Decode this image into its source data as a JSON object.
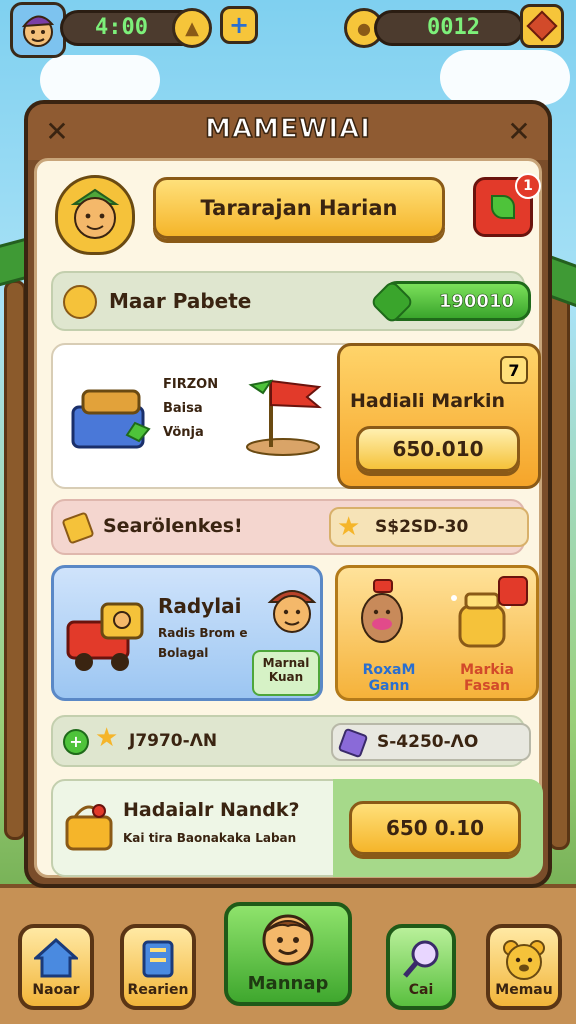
{
  "top_bar": {
    "timer": "4:00",
    "counter": "0012",
    "avatar_icon": "player-avatar-icon",
    "add_icon": "plus-icon",
    "coin_icon": "coin-icon",
    "gem_icon": "gem-icon"
  },
  "panel": {
    "title": "MAMEWIAI",
    "header_button": "Tararajan Harian",
    "notification_count": "1",
    "section1": {
      "label": "Maar Pabete",
      "value": "190010"
    },
    "card1": {
      "text_lines": [
        "FIRZON",
        "Baisa",
        "Vönja"
      ],
      "gold_title": "Hadiali Markin",
      "gold_badge": "7",
      "gold_button": "650.010"
    },
    "section2": {
      "label": "Searölenkes!",
      "value": "S$2SD-30"
    },
    "card2": {
      "title": "Radylai",
      "sub1": "Radis Brom e",
      "sub2": "Bolagal",
      "tag1": "Marnal",
      "tag2": "Kuan",
      "right_label1_a": "RoxaM",
      "right_label1_b": "Gann",
      "right_label2_a": "Markia",
      "right_label2_b": "Fasan"
    },
    "section3": {
      "value_left": "J7970-ΛN",
      "value_right": "S-4250-ΛO"
    },
    "card3": {
      "title": "Hadaialr Nandk?",
      "subtitle": "Kai tira Baonakaka Laban",
      "button": "650 0.10"
    }
  },
  "bottom_nav": [
    {
      "label": "Naoar",
      "icon": "home-icon"
    },
    {
      "label": "Rearien",
      "icon": "scroll-icon"
    },
    {
      "label": "Mannap",
      "icon": "character-icon"
    },
    {
      "label": "Cai",
      "icon": "magnifier-icon"
    },
    {
      "label": "Memau",
      "icon": "bear-icon"
    }
  ],
  "colors": {
    "accent_gold": "#f5b52a",
    "accent_green": "#3aa52c",
    "panel_wood": "#7a4d2a",
    "badge_red": "#e23a2a"
  }
}
